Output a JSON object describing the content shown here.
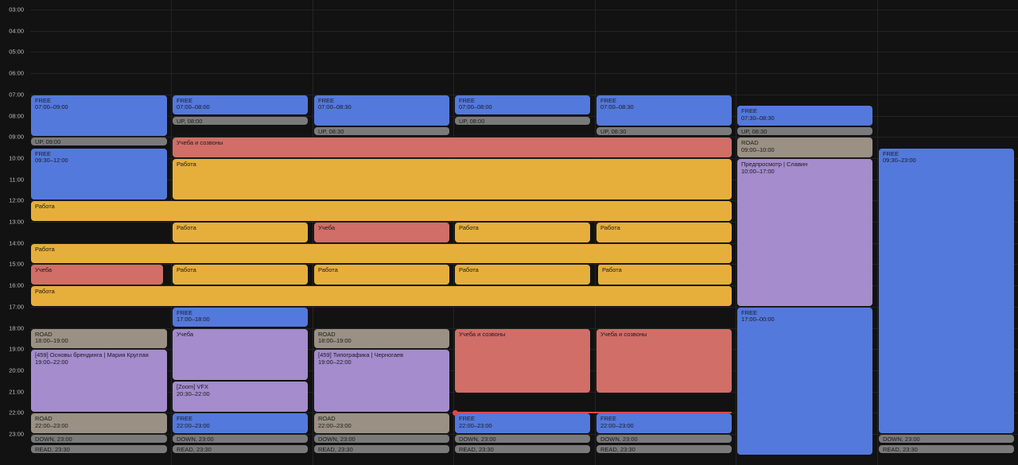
{
  "hours": [
    "03:00",
    "04:00",
    "05:00",
    "06:00",
    "07:00",
    "08:00",
    "09:00",
    "10:00",
    "11:00",
    "12:00",
    "13:00",
    "14:00",
    "15:00",
    "16:00",
    "17:00",
    "18:00",
    "19:00",
    "20:00",
    "21:00",
    "22:00",
    "23:00"
  ],
  "events": [
    {
      "title": "FREE",
      "time": "07:00–09:00",
      "type": "free"
    },
    {
      "title": "UP, 09:00",
      "time": "",
      "type": "gray"
    },
    {
      "title": "FREE",
      "time": "09:30–12:00",
      "type": "free"
    },
    {
      "title": "Работа",
      "time": "",
      "type": "work"
    },
    {
      "title": "Работа",
      "time": "",
      "type": "work"
    },
    {
      "title": "Учеба",
      "time": "",
      "type": "study"
    },
    {
      "title": "Работа",
      "time": "",
      "type": "work"
    },
    {
      "title": "ROAD",
      "time": "18:00–19:00",
      "type": "road"
    },
    {
      "title": "[459] Основы брендинга | Мария Круглая",
      "time": "19:00–22:00",
      "type": "purple"
    },
    {
      "title": "ROAD",
      "time": "22:00–23:00",
      "type": "road"
    },
    {
      "title": "DOWN, 23:00",
      "time": "",
      "type": "gray"
    },
    {
      "title": "READ, 23:30",
      "time": "",
      "type": "gray"
    },
    {
      "title": "FREE",
      "time": "07:00–08:00",
      "type": "free"
    },
    {
      "title": "UP, 08:00",
      "time": "",
      "type": "gray"
    },
    {
      "title": "Учеба и созвоны",
      "time": "",
      "type": "study"
    },
    {
      "title": "Работа",
      "time": "",
      "type": "work"
    },
    {
      "title": "Работа",
      "time": "",
      "type": "work"
    },
    {
      "title": "Работа",
      "time": "",
      "type": "work"
    },
    {
      "title": "FREE",
      "time": "17:00–18:00",
      "type": "free"
    },
    {
      "title": "Учеба",
      "time": "",
      "type": "purple"
    },
    {
      "title": "[Zoom] VFX",
      "time": "20:30–22:00",
      "type": "purple"
    },
    {
      "title": "FREE",
      "time": "22:00–23:00",
      "type": "free"
    },
    {
      "title": "DOWN, 23:00",
      "time": "",
      "type": "gray"
    },
    {
      "title": "READ, 23:30",
      "time": "",
      "type": "gray"
    },
    {
      "title": "FREE",
      "time": "07:00–08:30",
      "type": "free"
    },
    {
      "title": "UP, 08:30",
      "time": "",
      "type": "gray"
    },
    {
      "title": "Учеба",
      "time": "",
      "type": "study"
    },
    {
      "title": "Работа",
      "time": "",
      "type": "work"
    },
    {
      "title": "ROAD",
      "time": "18:00–19:00",
      "type": "road"
    },
    {
      "title": "[459] Типографика | Черногаев",
      "time": "19:00–22:00",
      "type": "purple"
    },
    {
      "title": "ROAD",
      "time": "22:00–23:00",
      "type": "road"
    },
    {
      "title": "DOWN, 23:00",
      "time": "",
      "type": "gray"
    },
    {
      "title": "READ, 23:30",
      "time": "",
      "type": "gray"
    },
    {
      "title": "FREE",
      "time": "07:00–08:00",
      "type": "free"
    },
    {
      "title": "UP, 08:00",
      "time": "",
      "type": "gray"
    },
    {
      "title": "Работа",
      "time": "",
      "type": "work"
    },
    {
      "title": "Работа",
      "time": "",
      "type": "work"
    },
    {
      "title": "Учеба и созвоны",
      "time": "",
      "type": "study"
    },
    {
      "title": "FREE",
      "time": "22:00–23:00",
      "type": "free"
    },
    {
      "title": "DOWN, 23:00",
      "time": "",
      "type": "gray"
    },
    {
      "title": "READ, 23:30",
      "time": "",
      "type": "gray"
    },
    {
      "title": "FREE",
      "time": "07:00–08:30",
      "type": "free"
    },
    {
      "title": "UP, 08:30",
      "time": "",
      "type": "gray"
    },
    {
      "title": "Работа",
      "time": "",
      "type": "work"
    },
    {
      "title": "Работа",
      "time": "",
      "type": "work"
    },
    {
      "title": "Учеба и созвоны",
      "time": "",
      "type": "study"
    },
    {
      "title": "FREE",
      "time": "22:00–23:00",
      "type": "free"
    },
    {
      "title": "DOWN, 23:00",
      "time": "",
      "type": "gray"
    },
    {
      "title": "READ, 23:30",
      "time": "",
      "type": "gray"
    },
    {
      "title": "FREE",
      "time": "07:30–08:30",
      "type": "free"
    },
    {
      "title": "UP, 08:30",
      "time": "",
      "type": "gray"
    },
    {
      "title": "ROAD",
      "time": "09:00–10:00",
      "type": "road"
    },
    {
      "title": "Предпросмотр | Славин",
      "time": "10:00–17:00",
      "type": "purple"
    },
    {
      "title": "FREE",
      "time": "17:00–00:00",
      "type": "free"
    },
    {
      "title": "FREE",
      "time": "09:30–23:00",
      "type": "free"
    },
    {
      "title": "DOWN, 23:00",
      "time": "",
      "type": "gray"
    },
    {
      "title": "READ, 23:30",
      "time": "",
      "type": "gray"
    }
  ],
  "colors": {
    "free": "#5479dc",
    "gray": "#7a7a7a",
    "road": "#9a9184",
    "study": "#d06e67",
    "work": "#e6af3b",
    "purple": "#a48ccd",
    "now_line": "#d74a4a"
  }
}
